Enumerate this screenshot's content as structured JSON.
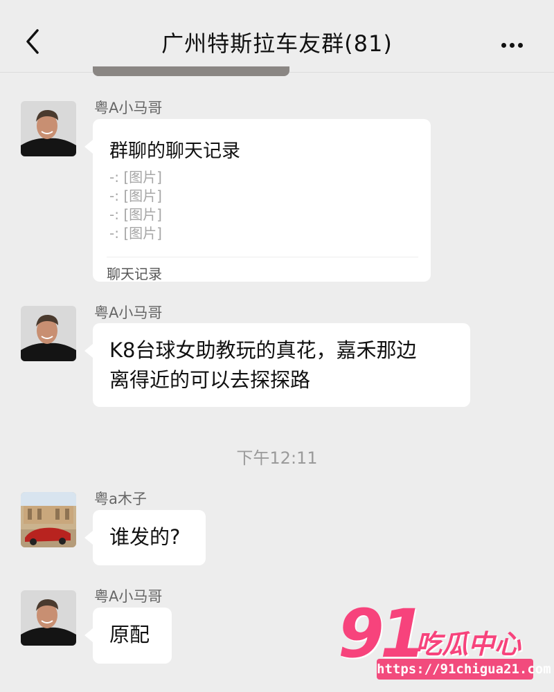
{
  "header": {
    "title": "广州特斯拉车友群(81)"
  },
  "messages": [
    {
      "sender": "粤A小马哥",
      "type": "chat_record",
      "record_title": "群聊的聊天记录",
      "record_lines": [
        "-: [图片]",
        "-: [图片]",
        "-: [图片]",
        "-: [图片]"
      ],
      "record_footer": "聊天记录"
    },
    {
      "sender": "粤A小马哥",
      "type": "text",
      "text_line1": "K8台球女助教玩的真花，嘉禾那边",
      "text_line2": "离得近的可以去探探路"
    },
    {
      "timestamp": "下午12:11"
    },
    {
      "sender": "粤a木子",
      "type": "text",
      "text": "谁发的?"
    },
    {
      "sender": "粤A小马哥",
      "type": "text",
      "text": "原配"
    }
  ],
  "watermark": {
    "number": "91",
    "text": "吃瓜中心",
    "url": "https://91chigua21.com"
  },
  "colors": {
    "background": "#ededed",
    "bubble": "#ffffff",
    "watermark": "#f7437c"
  }
}
